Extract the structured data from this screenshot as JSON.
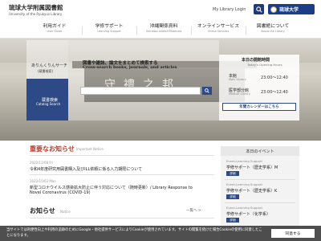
{
  "header": {
    "title": "琉球大学附属図書館",
    "subtitle": "University of the Ryukyus Library",
    "login": "My Library Login",
    "university": "琉球大学",
    "search_icon": "search-icon",
    "brand_color": "#1a3d86"
  },
  "nav": [
    {
      "jp": "利用ガイド",
      "en": "User Guide"
    },
    {
      "jp": "学修サポート",
      "en": "Learning Support"
    },
    {
      "jp": "沖縄関係資料",
      "en": "Okinawa-related Materials"
    },
    {
      "jp": "オンラインサービス",
      "en": "Online Services"
    },
    {
      "jp": "図書館について",
      "en": "About the Library"
    }
  ],
  "hero": {
    "ari_title": "ありんくりんサーチ",
    "ari_sub": "(蔵書検索)",
    "catalog_jp": "蔵書検索",
    "catalog_en": "Catalog Search",
    "search_title": "図書や雑誌、論文をまとめて検索する",
    "search_en": "Cross-search books, journals, and articles",
    "gate_text": "守禮之邦"
  },
  "hours": {
    "title": "本日の開館時間",
    "subtitle": "Today's Opening Hours",
    "rows": [
      {
        "label": "本館",
        "en": "Main Library",
        "time": "23:00～12:40"
      },
      {
        "label": "医学部分館",
        "en": "Medical Library",
        "time": "23:00～12:40"
      }
    ],
    "calendar": "年間カレンダーはこちら"
  },
  "main": {
    "important_title": "重要なお知らせ",
    "important_en": "Important Notice",
    "news": [
      {
        "date": "2022/12/08 Fri",
        "text": "令和4年度研究用図書購入及びILL依頼に係る入力期限について"
      },
      {
        "date": "2022/10/03 Mon",
        "text": "新型コロナウイルス感染拡大防止に伴う対応について（随時更新）/ Library Response to"
      },
      {
        "date": "",
        "text": "Novel Coronavirus (COVID-19)"
      }
    ],
    "notice_title": "お知らせ",
    "notice_en": "Notice",
    "more": "一覧へ >"
  },
  "events": {
    "title": "本日のイベント",
    "items": [
      {
        "date": "Event-Learning Support",
        "title": "学修サポート（歴史学系）M",
        "btn": "詳細"
      },
      {
        "date": "Event-Learning Support",
        "title": "学修サポート（歴史学系）K",
        "btn": "詳細"
      },
      {
        "date": "Event-Learning Support",
        "title": "学修サポート（化学系）",
        "btn": "詳細"
      }
    ]
  },
  "cookie": {
    "text": "当サイトでは利便性向上や利用の追跡のためにGoogle・他社提供サービスによりCookieが使用されています。サイトの閲覧を続けた場合Cookieの使用に同意したことになります。",
    "button": "同意する"
  }
}
